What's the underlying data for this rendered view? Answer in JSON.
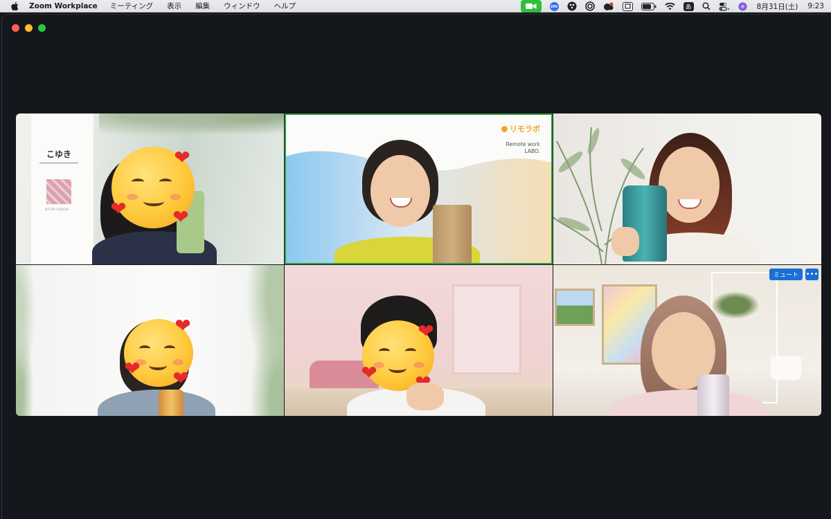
{
  "menubar": {
    "app_name": "Zoom Workplace",
    "items": [
      "ミーティング",
      "表示",
      "編集",
      "ウィンドウ",
      "ヘルプ"
    ],
    "input_method": "あ",
    "date": "8月31日(土)",
    "time": "9:23",
    "zoom_badge": "zm"
  },
  "tiles": [
    {
      "sign_name": "こゆき",
      "sign_caption": "NATOK RIBBON"
    },
    {
      "brand_name": "リモラボ",
      "brand_sub_line1": "Remote work",
      "brand_sub_line2": "LABO."
    },
    {},
    {},
    {},
    {
      "mute_label": "ミュート",
      "more_label": "•••"
    }
  ],
  "colors": {
    "active_speaker_border": "#2d9c3c",
    "mute_button": "#1a6fd6",
    "brand_orange": "#f0a32a",
    "video_indicator": "#2fbf3a"
  }
}
